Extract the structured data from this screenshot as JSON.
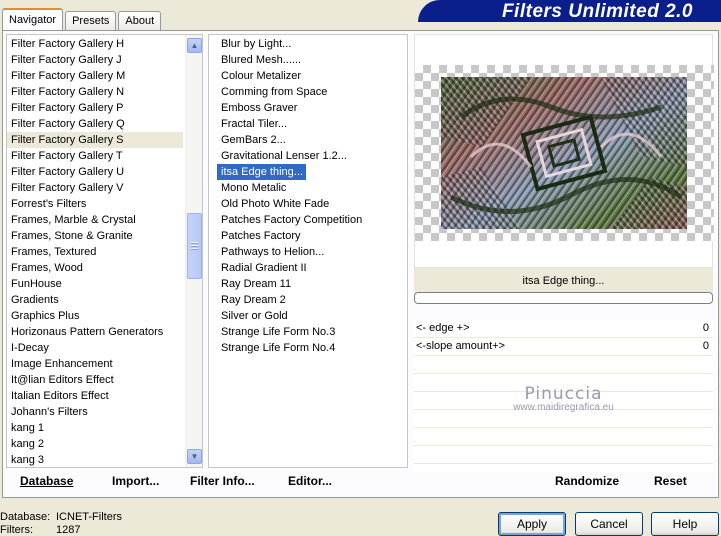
{
  "tabs": [
    "Navigator",
    "Presets",
    "About"
  ],
  "banner": "Filters Unlimited 2.0",
  "categories": [
    "Filter Factory Gallery H",
    "Filter Factory Gallery J",
    "Filter Factory Gallery M",
    "Filter Factory Gallery N",
    "Filter Factory Gallery P",
    "Filter Factory Gallery Q",
    "Filter Factory Gallery S",
    "Filter Factory Gallery T",
    "Filter Factory Gallery U",
    "Filter Factory Gallery V",
    "Forrest's Filters",
    "Frames, Marble & Crystal",
    "Frames, Stone & Granite",
    "Frames, Textured",
    "Frames, Wood",
    "FunHouse",
    "Gradients",
    "Graphics Plus",
    "Horizonaus Pattern Generators",
    "I-Decay",
    "Image Enhancement",
    "It@lian Editors Effect",
    "Italian Editors Effect",
    "Johann's Filters",
    "kang 1",
    "kang 2",
    "kang 3"
  ],
  "selected_category": "Filter Factory Gallery S",
  "filters": [
    "Blur by Light...",
    "Blured Mesh......",
    "Colour Metalizer",
    "Comming from Space",
    "Emboss Graver",
    "Fractal Tiler...",
    "GemBars 2...",
    "Gravitational Lenser 1.2...",
    "itsa Edge thing...",
    "Mono Metalic",
    "Old Photo White Fade",
    "Patches Factory Competition",
    "Patches Factory",
    "Pathways to Helion...",
    "Radial Gradient II",
    "Ray Dream 11",
    "Ray Dream 2",
    "Silver or Gold",
    "Strange Life Form No.3",
    "Strange Life Form No.4"
  ],
  "selected_filter": "itsa Edge thing...",
  "filter_title": "itsa Edge thing...",
  "params": [
    {
      "label": "<- edge +>",
      "value": "0"
    },
    {
      "label": "<-slope amount+>",
      "value": "0"
    }
  ],
  "watermark": {
    "name": "Pinuccia",
    "url": "www.maidiregrafica.eu"
  },
  "left_buttons": {
    "database": "Database",
    "import": "Import...",
    "filter_info": "Filter Info...",
    "editor": "Editor..."
  },
  "right_buttons": {
    "randomize": "Randomize",
    "reset": "Reset"
  },
  "status": {
    "database_label": "Database:",
    "database_value": "ICNET-Filters",
    "filters_label": "Filters:",
    "filters_value": "1287"
  },
  "dialog_buttons": {
    "apply": "Apply",
    "cancel": "Cancel",
    "help": "Help"
  }
}
